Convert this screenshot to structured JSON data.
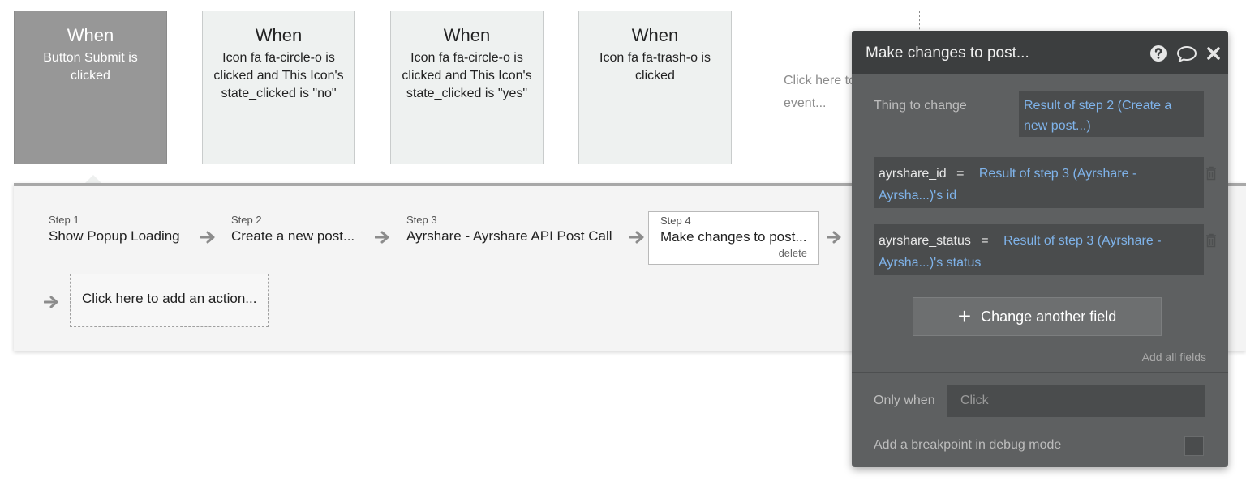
{
  "events": [
    {
      "when": "When",
      "desc": "Button Submit is clicked"
    },
    {
      "when": "When",
      "desc": "Icon fa fa-circle-o is clicked and This Icon's state_clicked is \"no\""
    },
    {
      "when": "When",
      "desc": "Icon fa fa-circle-o is clicked and This Icon's state_clicked is \"yes\""
    },
    {
      "when": "When",
      "desc": "Icon fa fa-trash-o is clicked"
    }
  ],
  "add_event_text": "Click here to add an event...",
  "steps": [
    {
      "num": "Step 1",
      "name": "Show Popup Loading"
    },
    {
      "num": "Step 2",
      "name": "Create a new post..."
    },
    {
      "num": "Step 3",
      "name": "Ayrshare - Ayrshare API Post Call"
    },
    {
      "num": "Step 4",
      "name": "Make changes to post...",
      "delete": "delete"
    }
  ],
  "add_action_text": "Click here to add an action...",
  "editor": {
    "title": "Make changes to post...",
    "thing_label": "Thing to change",
    "thing_value": "Result of step 2 (Create a new post...)",
    "fields": [
      {
        "name": "ayrshare_id",
        "eq": "=",
        "value": "Result of step 3 (Ayrshare - Ayrsha...)'s id"
      },
      {
        "name": "ayrshare_status",
        "eq": "=",
        "value": "Result of step 3 (Ayrshare - Ayrsha...)'s status"
      }
    ],
    "change_another": "Change another field",
    "add_all": "Add all fields",
    "only_when_label": "Only when",
    "only_when_placeholder": "Click",
    "breakpoint_label": "Add a breakpoint in debug mode"
  },
  "colors": {
    "selected_card": "#979797",
    "card": "#eef1f0",
    "editor_bg": "#5e6061",
    "editor_header": "#3c3e3f",
    "link": "#7fb3ea"
  }
}
